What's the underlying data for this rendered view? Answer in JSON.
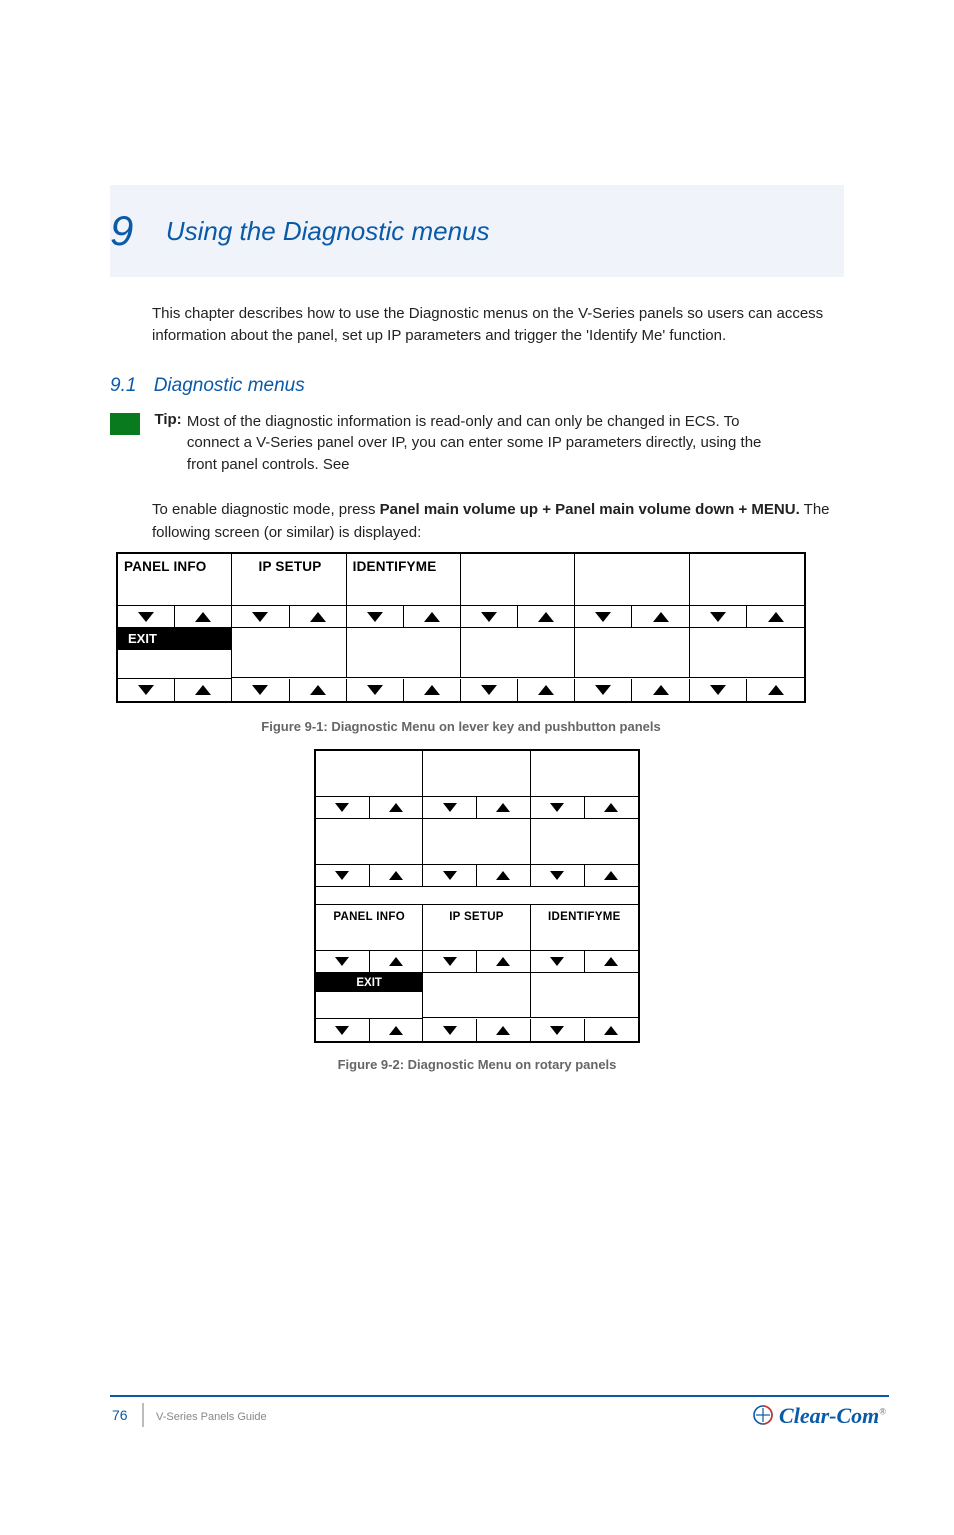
{
  "chapter": {
    "num": "9",
    "title": "Using the Diagnostic menus"
  },
  "intro": "This chapter describes how to use the Diagnostic menus on the V-Series panels so users can access information about the panel, set up IP parameters and trigger the 'Identify Me' function.",
  "section": {
    "num": "9.1",
    "title": "Diagnostic menus"
  },
  "tip": {
    "label": "Tip:",
    "text": "Most of the diagnostic information is read-only and can only be changed in ECS. To connect a V-Series panel over IP, you can enter some IP parameters directly, using the front panel controls. See"
  },
  "para1_lead": "To enable diagnostic mode, press",
  "para1_strong": "Panel main volume up + Panel main volume down + MENU.",
  "para1_tail": " The following screen (or similar) is displayed:",
  "m": {
    "panel_info": "PANEL INFO",
    "ip_setup": "IP SETUP",
    "identifyme": "IDENTIFYME",
    "exit": "EXIT"
  },
  "fig1": "Figure 9-1: Diagnostic Menu on lever key and pushbutton panels",
  "fig2": "Figure 9-2: Diagnostic Menu on rotary panels",
  "footer": {
    "page": "76",
    "doc": "V-Series Panels Guide"
  },
  "logo": "Clear-Com"
}
